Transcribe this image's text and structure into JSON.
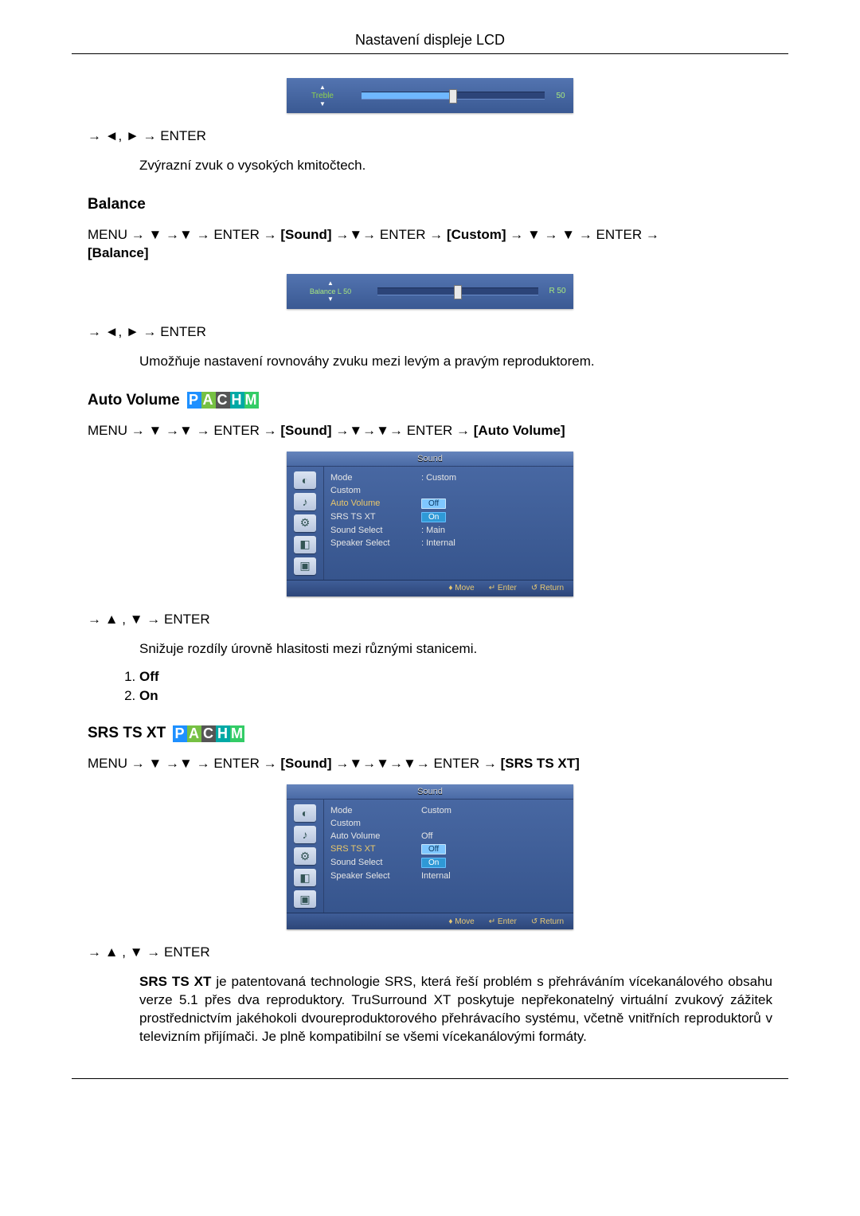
{
  "page": {
    "header": "Nastavení displeje LCD"
  },
  "treble": {
    "osd_label": "Treble",
    "osd_value": "50",
    "nav": "→ ◄, ► → ENTER",
    "desc": "Zvýrazní zvuk o vysokých kmitočtech."
  },
  "balance": {
    "heading": "Balance",
    "menu_path": {
      "pre": "MENU → ▼ →▼ → ENTER → ",
      "sound": "[Sound]",
      "mid1": " →▼→ ENTER → ",
      "custom": "[Custom]",
      "mid2": " → ▼ → ▼ → ENTER → ",
      "balance": "[Balance]"
    },
    "osd_label_l": "Balance  L  50",
    "osd_label_r": "R  50",
    "nav": "→ ◄, ► → ENTER",
    "desc": "Umožňuje nastavení rovnováhy zvuku mezi levým a pravým reproduktorem."
  },
  "autovol": {
    "heading": "Auto Volume",
    "menu_path": {
      "pre": "MENU → ▼ →▼ → ENTER → ",
      "sound": "[Sound]",
      "mid1": " →▼→▼→ ENTER → ",
      "target": "[Auto Volume]"
    },
    "osd": {
      "title": "Sound",
      "rows": {
        "mode_k": "Mode",
        "mode_v": ": Custom",
        "custom_k": "Custom",
        "av_k": "Auto Volume",
        "av_off": "Off",
        "av_on": "On",
        "srs_k": "SRS TS XT",
        "ss_k": "Sound Select",
        "ss_v": ": Main",
        "spk_k": "Speaker Select",
        "spk_v": ": Internal"
      },
      "footer": {
        "move": "Move",
        "enter": "Enter",
        "return": "Return"
      }
    },
    "nav": "→ ▲ , ▼ → ENTER",
    "desc": "Snižuje rozdíly úrovně hlasitosti mezi různými stanicemi.",
    "opt1": "Off",
    "opt2": "On"
  },
  "srs": {
    "heading": "SRS TS XT",
    "menu_path": {
      "pre": "MENU → ▼ →▼ → ENTER → ",
      "sound": "[Sound]",
      "mid1": " →▼→▼→▼→ ENTER → ",
      "target": "[SRS TS XT]"
    },
    "osd": {
      "title": "Sound",
      "rows": {
        "mode_k": "Mode",
        "mode_v": "Custom",
        "custom_k": "Custom",
        "av_k": "Auto Volume",
        "av_v": "Off",
        "srs_k": "SRS TS XT",
        "srs_off": "Off",
        "srs_on": "On",
        "ss_k": "Sound Select",
        "spk_k": "Speaker Select",
        "spk_v": "Internal"
      },
      "footer": {
        "move": "Move",
        "enter": "Enter",
        "return": "Return"
      }
    },
    "nav": "→ ▲ , ▼ → ENTER",
    "desc_lead": "SRS TS XT",
    "desc": " je patentovaná technologie SRS, která řeší problém s přehráváním vícekanálového obsahu verze 5.1 přes dva reproduktory. TruSurround XT poskytuje nepřekonatelný virtuální zvukový zážitek prostřednictvím jakéhokoli dvoureproduktorového přehrávacího systému, včetně vnitřních reproduktorů v televizním přijímači. Je plně kompatibilní se všemi vícekanálovými formáty."
  },
  "pachm": {
    "p": "P",
    "a": "A",
    "c": "C",
    "h": "H",
    "m": "M"
  }
}
